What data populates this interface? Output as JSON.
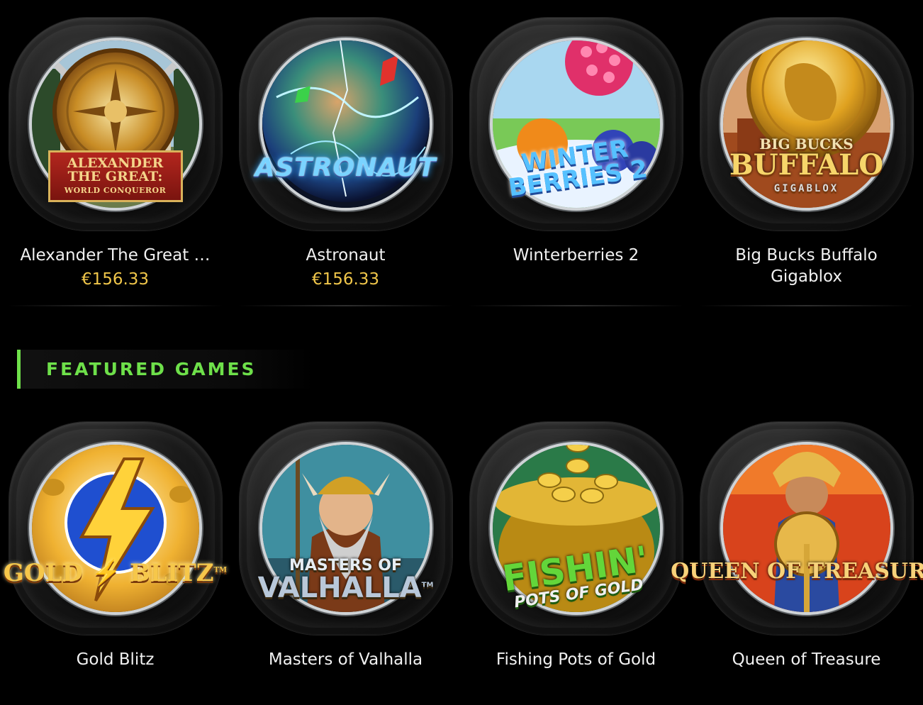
{
  "top_row": [
    {
      "name": "Alexander The Great …",
      "jackpot": "€156.33",
      "logo": [
        "ALEXANDER",
        "THE GREAT:",
        "WORLD CONQUEROR"
      ],
      "icon": "alexander-shield-icon"
    },
    {
      "name": "Astronaut",
      "jackpot": "€156.33",
      "logo": [
        "ASTRONAUT"
      ],
      "icon": "astronaut-planet-icon"
    },
    {
      "name": "Winterberries 2",
      "logo": [
        "WINTER",
        "BERRIES",
        "2"
      ],
      "icon": "winterberries-icon"
    },
    {
      "name": "Big Bucks Buffalo Gigablox",
      "logo": [
        "BIG BUCKS",
        "BUFFALO",
        "GIGABLOX"
      ],
      "icon": "buffalo-coin-icon"
    }
  ],
  "featured": {
    "title": "FEATURED GAMES",
    "accent_color": "#6ee04a",
    "games": [
      {
        "name": "Gold Blitz",
        "logo": [
          "GOLD",
          "BLITZ",
          "TM"
        ],
        "icon": "lightning-icon"
      },
      {
        "name": "Masters of Valhalla",
        "logo": [
          "MASTERS OF",
          "VALHALLA",
          "TM"
        ],
        "icon": "viking-icon"
      },
      {
        "name": "Fishing Pots of Gold",
        "logo": [
          "FISHIN'",
          "POTS OF GOLD"
        ],
        "icon": "pot-of-gold-icon"
      },
      {
        "name": "Queen of Treasure",
        "logo": [
          "QUEEN OF TREASURE"
        ],
        "icon": "queen-icon"
      }
    ]
  },
  "colors": {
    "background": "#000000",
    "jackpot": "#f0c64a",
    "text": "#f2f2f2"
  }
}
